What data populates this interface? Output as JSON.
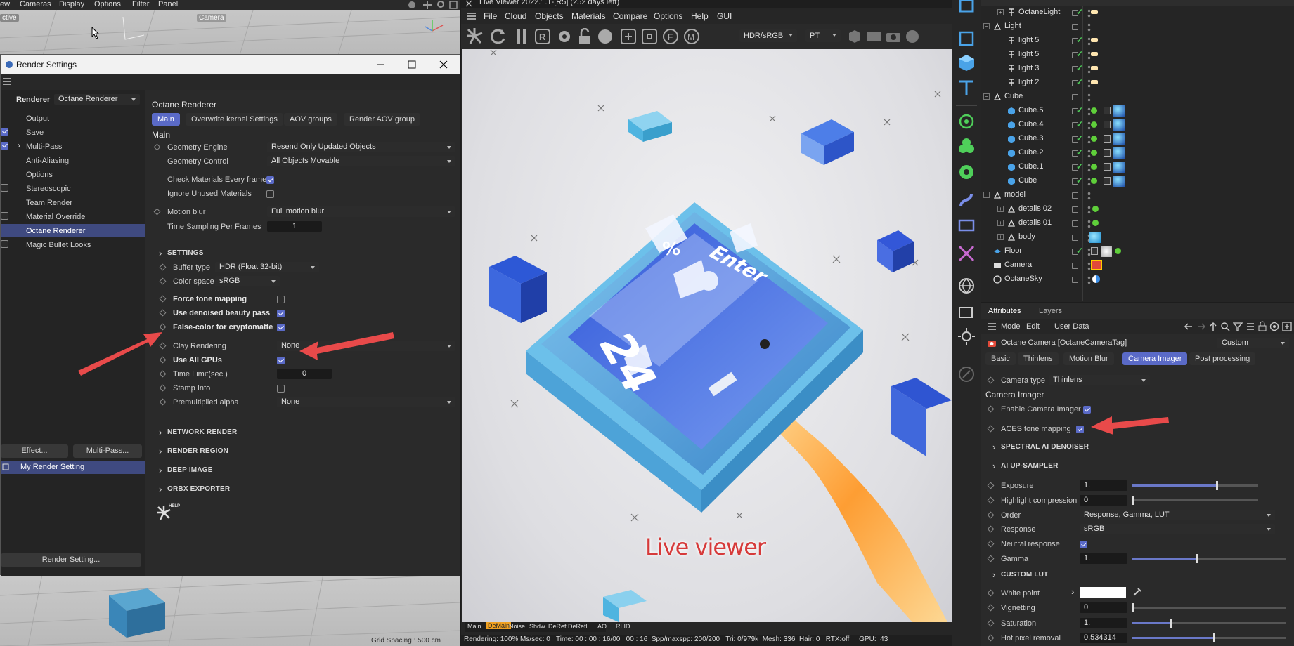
{
  "top_viewport": {
    "menu": [
      "ew",
      "Cameras",
      "Display",
      "Options",
      "Filter",
      "Panel"
    ],
    "label_active": "ctive",
    "label_camera": "Camera"
  },
  "render_settings": {
    "title": "Render Settings",
    "renderer_label": "Renderer",
    "renderer_value": "Octane Renderer",
    "items": [
      "Output",
      "Save",
      "Multi-Pass",
      "Anti-Aliasing",
      "Options",
      "Stereoscopic",
      "Team Render",
      "Material Override",
      "Octane Renderer",
      "Magic Bullet Looks"
    ],
    "effect_button": "Effect...",
    "multipass_button": "Multi-Pass...",
    "preset": "My Render Setting",
    "bottom_button": "Render Setting...",
    "panel_title": "Octane Renderer",
    "tabs": [
      "Main",
      "Overwrite kernel Settings",
      "AOV groups",
      "Render AOV group"
    ],
    "main_header": "Main",
    "geometry_engine_label": "Geometry Engine",
    "geometry_engine_value": "Resend Only Updated Objects",
    "geometry_control_label": "Geometry Control",
    "geometry_control_value": "All Objects Movable",
    "check_materials_label": "Check Materials Every frame",
    "ignore_unused_label": "Ignore Unused Materials",
    "motion_blur_label": "Motion blur",
    "motion_blur_value": "Full motion blur",
    "time_sampling_label": "Time Sampling Per Frames",
    "time_sampling_value": "1",
    "settings_header": "SETTINGS",
    "buffer_type_label": "Buffer type",
    "buffer_type_value": "HDR (Float 32-bit)",
    "color_space_label": "Color space",
    "color_space_value": "sRGB",
    "force_tone_label": "Force tone mapping",
    "denoised_label": "Use denoised beauty pass",
    "false_color_label": "False-color for cryptomatte",
    "clay_label": "Clay Rendering",
    "clay_value": "None",
    "all_gpus_label": "Use All GPUs",
    "time_limit_label": "Time Limit(sec.)",
    "time_limit_value": "0",
    "stamp_label": "Stamp Info",
    "premult_label": "Premultiplied alpha",
    "premult_value": "None",
    "network_header": "NETWORK RENDER",
    "region_header": "RENDER REGION",
    "deep_header": "DEEP IMAGE",
    "orbx_header": "ORBX EXPORTER",
    "help_label": "HELP"
  },
  "live_viewer": {
    "title": "Live Viewer 2022.1.1-[R5] (252 days left)",
    "menu": [
      "File",
      "Cloud",
      "Objects",
      "Materials",
      "Compare",
      "Options",
      "Help",
      "GUI"
    ],
    "color_dd": "HDR/sRGB",
    "mode_dd": "PT",
    "overlay_label": "Live viewer",
    "scene_text_enter": "Enter",
    "scene_text_num": "24",
    "scene_text_pct": "%",
    "bottom_tabs": [
      "Main",
      "DeMain",
      "Noise",
      "Shdw",
      "DeRefl",
      "DeRefl",
      "AO",
      "RLID"
    ],
    "status": "Rendering: 100% Ms/sec: 0   Time: 00 : 00 : 16/00 : 00 : 16  Spp/maxspp: 200/200   Tri: 0/979k  Mesh: 336  Hair: 0   RTX:off     GPU:  43",
    "grid_spacing": "Grid Spacing : 500 cm"
  },
  "object_manager": {
    "rows": [
      {
        "name": "OctaneLight",
        "indent": 1,
        "icon": "light"
      },
      {
        "name": "Light",
        "indent": 0,
        "icon": "null"
      },
      {
        "name": "light 5",
        "indent": 1,
        "icon": "light"
      },
      {
        "name": "light 5",
        "indent": 1,
        "icon": "light"
      },
      {
        "name": "light 3",
        "indent": 1,
        "icon": "light"
      },
      {
        "name": "light 2",
        "indent": 1,
        "icon": "light"
      },
      {
        "name": "Cube",
        "indent": 0,
        "icon": "null"
      },
      {
        "name": "Cube.5",
        "indent": 1,
        "icon": "cube"
      },
      {
        "name": "Cube.4",
        "indent": 1,
        "icon": "cube"
      },
      {
        "name": "Cube.3",
        "indent": 1,
        "icon": "cube"
      },
      {
        "name": "Cube.2",
        "indent": 1,
        "icon": "cube"
      },
      {
        "name": "Cube.1",
        "indent": 1,
        "icon": "cube"
      },
      {
        "name": "Cube",
        "indent": 1,
        "icon": "cube"
      },
      {
        "name": "model",
        "indent": 0,
        "icon": "null"
      },
      {
        "name": "details 02",
        "indent": 1,
        "icon": "null"
      },
      {
        "name": "details 01",
        "indent": 1,
        "icon": "null"
      },
      {
        "name": "body",
        "indent": 1,
        "icon": "null"
      },
      {
        "name": "Floor",
        "indent": 0,
        "icon": "floor"
      },
      {
        "name": "Camera",
        "indent": 0,
        "icon": "camera"
      },
      {
        "name": "OctaneSky",
        "indent": 0,
        "icon": "sky"
      }
    ]
  },
  "attributes": {
    "tab_attributes": "Attributes",
    "tab_layers": "Layers",
    "menu": [
      "Mode",
      "Edit",
      "User Data"
    ],
    "tag_title": "Octane Camera [OctaneCameraTag]",
    "tag_preset": "Custom",
    "tabs": [
      "Basic",
      "Thinlens",
      "Motion Blur",
      "Camera Imager",
      "Post processing"
    ],
    "camera_type_label": "Camera type",
    "camera_type_value": "Thinlens",
    "section_title": "Camera Imager",
    "enable_imager_label": "Enable Camera Imager",
    "aces_label": "ACES tone mapping",
    "spectral_header": "SPECTRAL AI DENOISER",
    "upsampler_header": "AI UP-SAMPLER",
    "exposure_label": "Exposure",
    "exposure_value": "1.",
    "exposure_level": 0.67,
    "highlight_label": "Highlight compression",
    "highlight_value": "0",
    "highlight_level": 0.0,
    "order_label": "Order",
    "order_value": "Response, Gamma, LUT",
    "response_label": "Response",
    "response_value": "sRGB",
    "neutral_label": "Neutral response",
    "gamma_label": "Gamma",
    "gamma_value": "1.",
    "gamma_level": 0.42,
    "custom_lut_header": "CUSTOM LUT",
    "white_point_label": "White point",
    "vignetting_label": "Vignetting",
    "vignetting_value": "0",
    "vignetting_level": 0.0,
    "saturation_label": "Saturation",
    "saturation_value": "1.",
    "saturation_level": 0.25,
    "hot_pixel_label": "Hot pixel removal",
    "hot_pixel_value": "0.534314",
    "hot_pixel_level": 0.53
  },
  "colors": {
    "accent": "#5a6ac7",
    "arrow": "#e84a4a",
    "check_green": "#4fcf5a"
  }
}
